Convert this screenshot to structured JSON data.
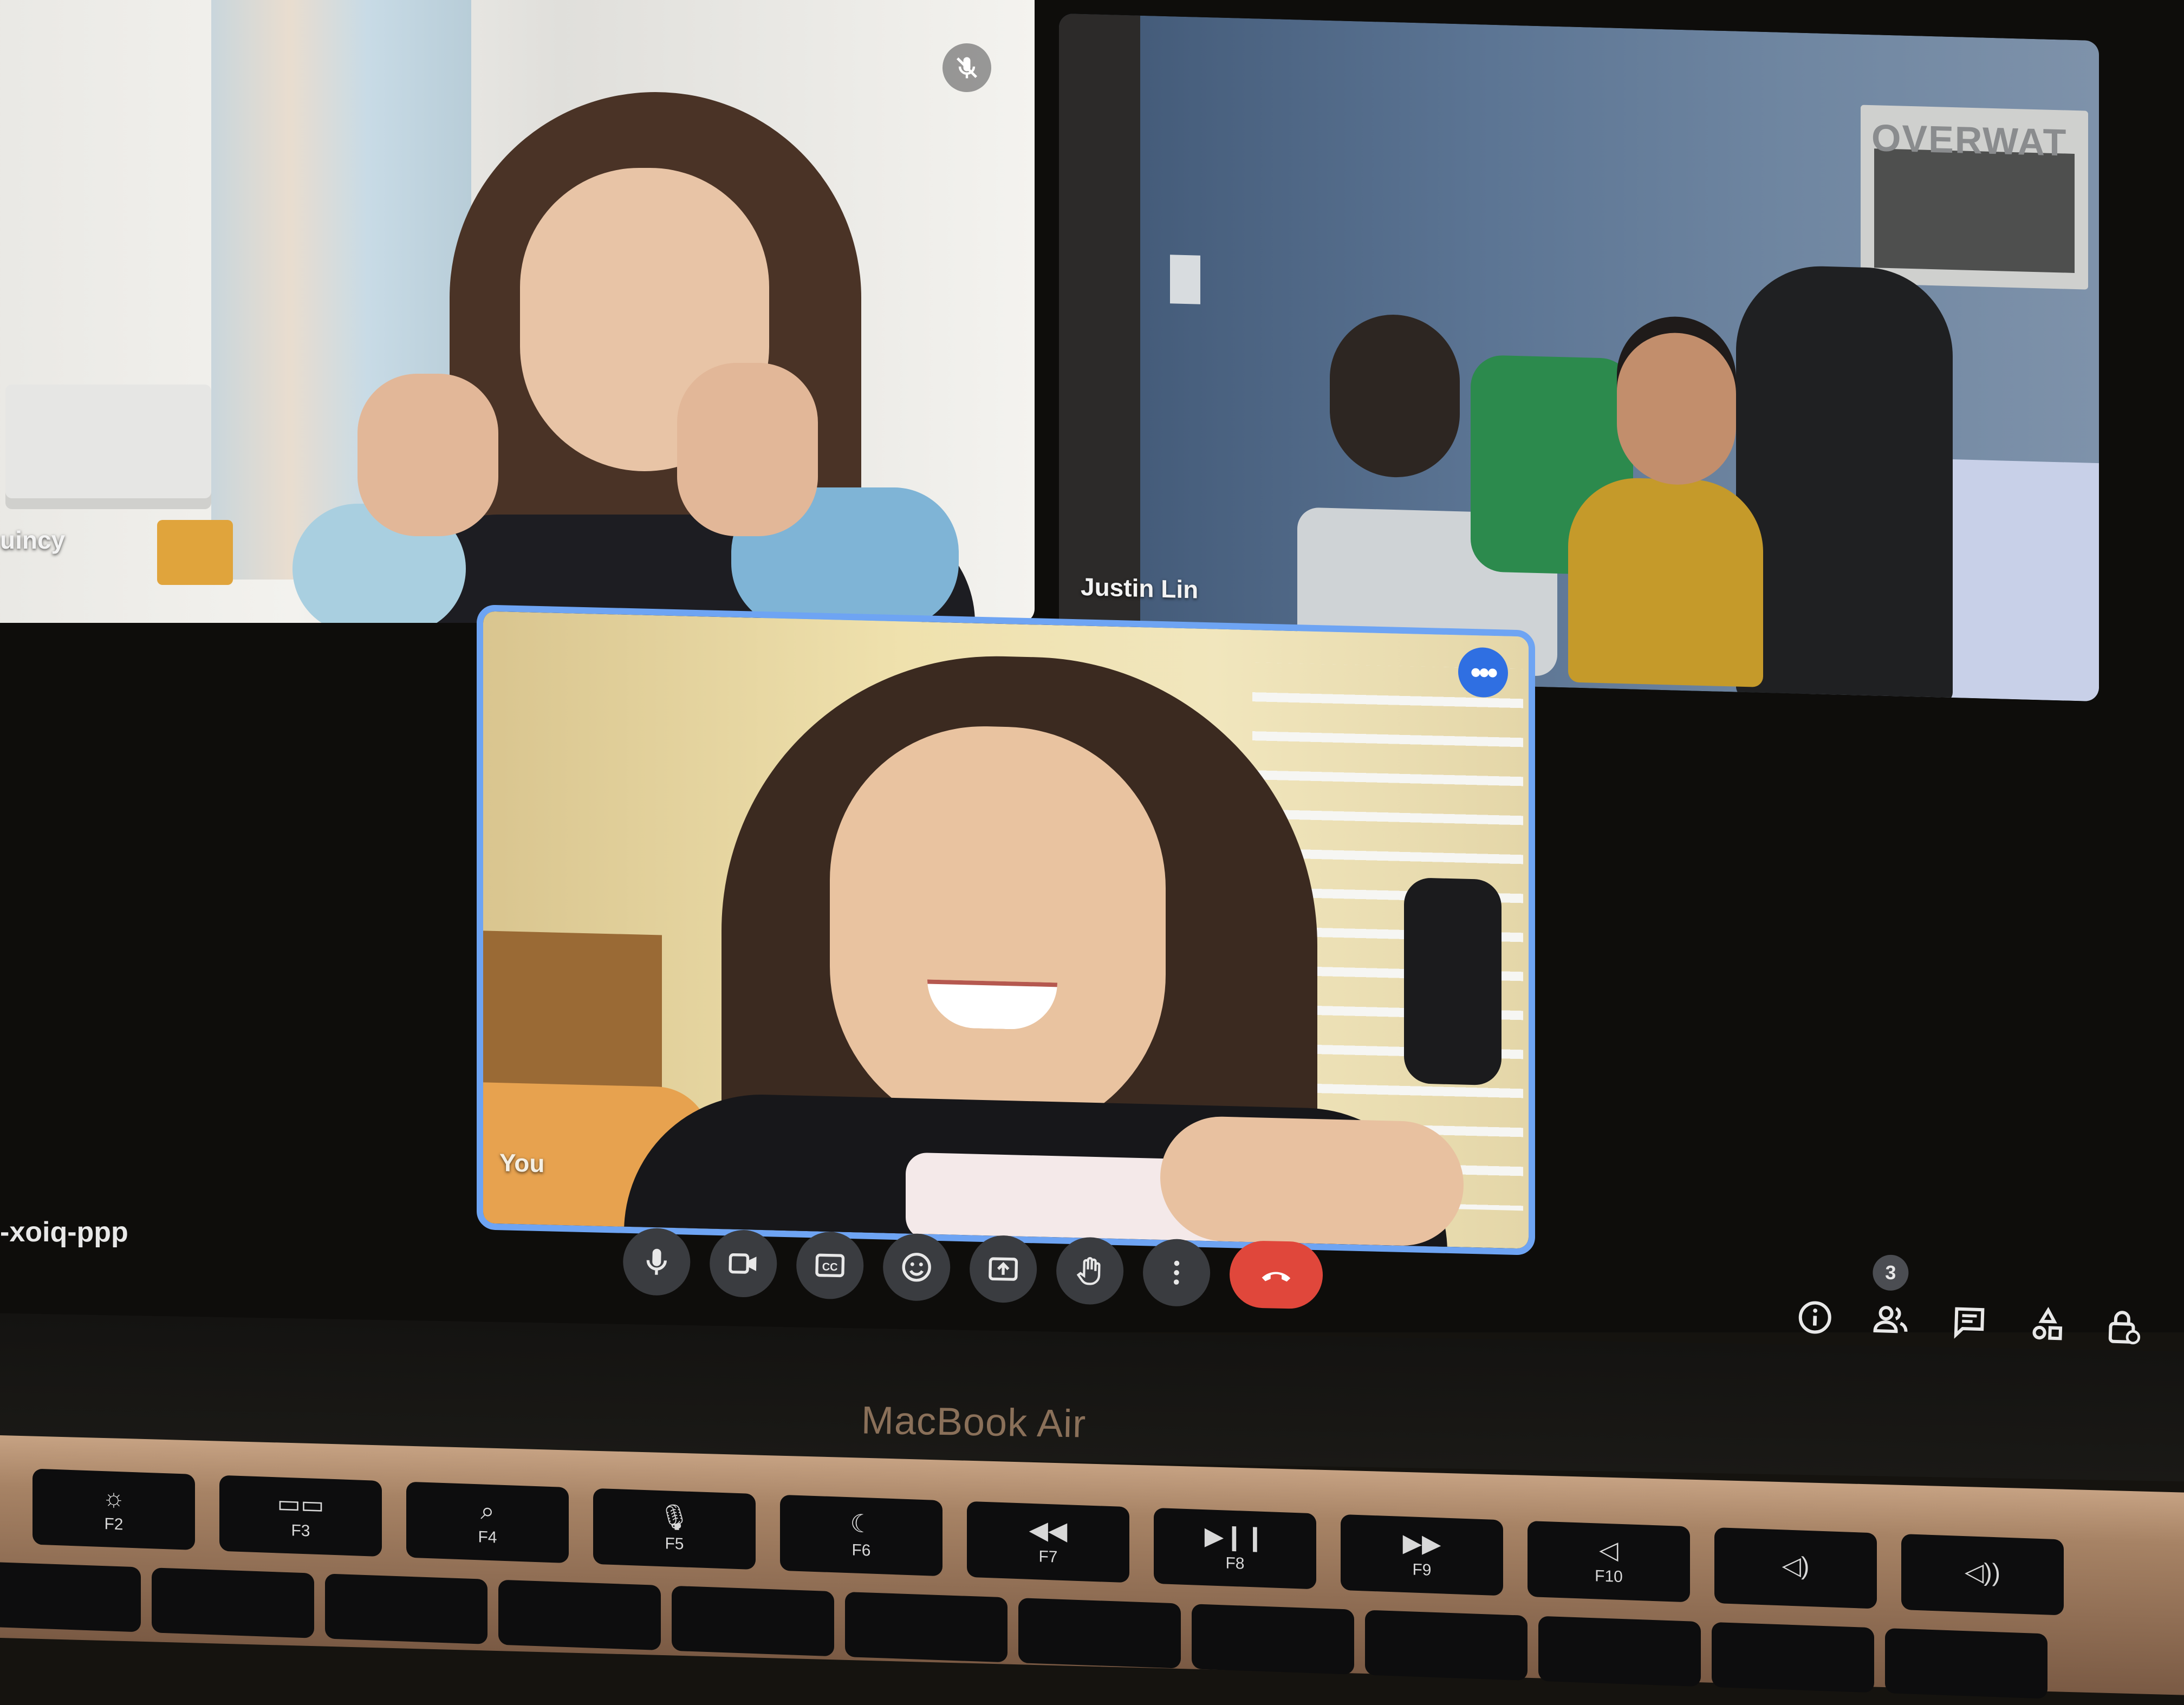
{
  "participants": [
    {
      "name": "uincy",
      "muted": true
    },
    {
      "name": "Justin Lin",
      "muted": false
    },
    {
      "name": "You",
      "muted": false
    }
  ],
  "meeting": {
    "code": "-xoiq-ppp"
  },
  "self_tile": {
    "menu_icon": "more-horiz-icon",
    "accent": "#6ea4f3"
  },
  "controls": [
    {
      "id": "mic",
      "icon": "microphone-icon"
    },
    {
      "id": "camera",
      "icon": "video-camera-icon"
    },
    {
      "id": "captions",
      "icon": "closed-captions-icon"
    },
    {
      "id": "reactions",
      "icon": "emoji-icon"
    },
    {
      "id": "present",
      "icon": "present-screen-icon"
    },
    {
      "id": "raise-hand",
      "icon": "raise-hand-icon"
    },
    {
      "id": "more",
      "icon": "more-vert-icon"
    },
    {
      "id": "leave",
      "icon": "hang-up-icon",
      "color": "#e0473b"
    }
  ],
  "right_tools": [
    {
      "id": "info",
      "icon": "info-icon"
    },
    {
      "id": "people",
      "icon": "people-icon",
      "badge": "3"
    },
    {
      "id": "chat",
      "icon": "chat-icon"
    },
    {
      "id": "activities",
      "icon": "activities-icon"
    },
    {
      "id": "host-controls",
      "icon": "lock-person-icon"
    }
  ],
  "laptop": {
    "brand": "MacBook Air"
  },
  "keyboard": {
    "keys": [
      {
        "label": "F2",
        "icon": "☼"
      },
      {
        "label": "F3",
        "icon": "▭▭"
      },
      {
        "label": "F4",
        "icon": "⌕"
      },
      {
        "label": "F5",
        "icon": "🎙"
      },
      {
        "label": "F6",
        "icon": "☾"
      },
      {
        "label": "F7",
        "icon": "◀◀"
      },
      {
        "label": "F8",
        "icon": "▶❙❙"
      },
      {
        "label": "F9",
        "icon": "▶▶"
      },
      {
        "label": "F10",
        "icon": "◁"
      },
      {
        "label": "",
        "icon": "◁)"
      },
      {
        "label": "",
        "icon": "◁))"
      }
    ]
  }
}
